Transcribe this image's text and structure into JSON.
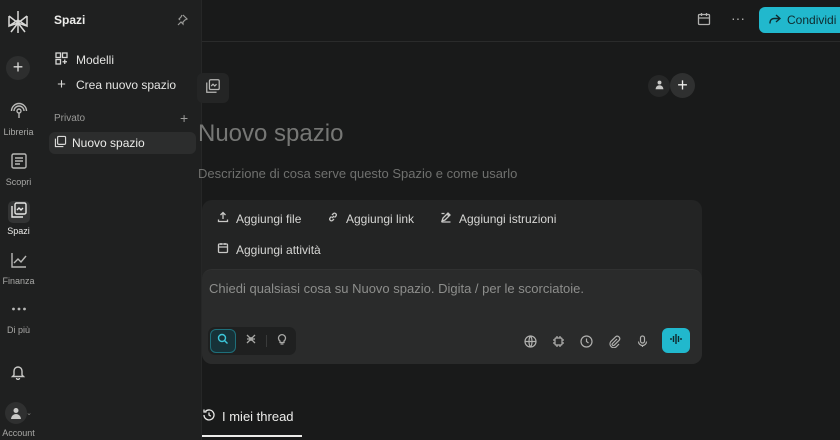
{
  "rail": {
    "items": [
      {
        "label": "Libreria",
        "icon": "library-icon"
      },
      {
        "label": "Scopri",
        "icon": "discover-icon"
      },
      {
        "label": "Spazi",
        "icon": "spaces-icon",
        "active": true
      },
      {
        "label": "Finanza",
        "icon": "finance-icon"
      },
      {
        "label": "Di più",
        "icon": "more-icon"
      }
    ],
    "account_label": "Account"
  },
  "sidebar": {
    "title": "Spazi",
    "links": [
      {
        "label": "Modelli",
        "icon": "templates-icon"
      },
      {
        "label": "Crea nuovo spazio",
        "icon": "plus-icon"
      }
    ],
    "section_label": "Privato",
    "spaces": [
      {
        "label": "Nuovo spazio"
      }
    ]
  },
  "topbar": {
    "share_label": "Condividi"
  },
  "main": {
    "title": "Nuovo spazio",
    "description": "Descrizione di cosa serve questo Spazio e come usarlo",
    "actions": [
      {
        "label": "Aggiungi file",
        "icon": "upload-icon"
      },
      {
        "label": "Aggiungi link",
        "icon": "link-icon"
      },
      {
        "label": "Aggiungi istruzioni",
        "icon": "edit-icon"
      },
      {
        "label": "Aggiungi attività",
        "icon": "calendar-icon"
      }
    ],
    "composer_placeholder": "Chiedi qualsiasi cosa su Nuovo spazio. Digita / per le scorciatoie.",
    "threads_tab": "I miei thread"
  },
  "colors": {
    "accent": "#21b8cd",
    "background": "#191a1a",
    "sidebar": "#1f2020"
  }
}
